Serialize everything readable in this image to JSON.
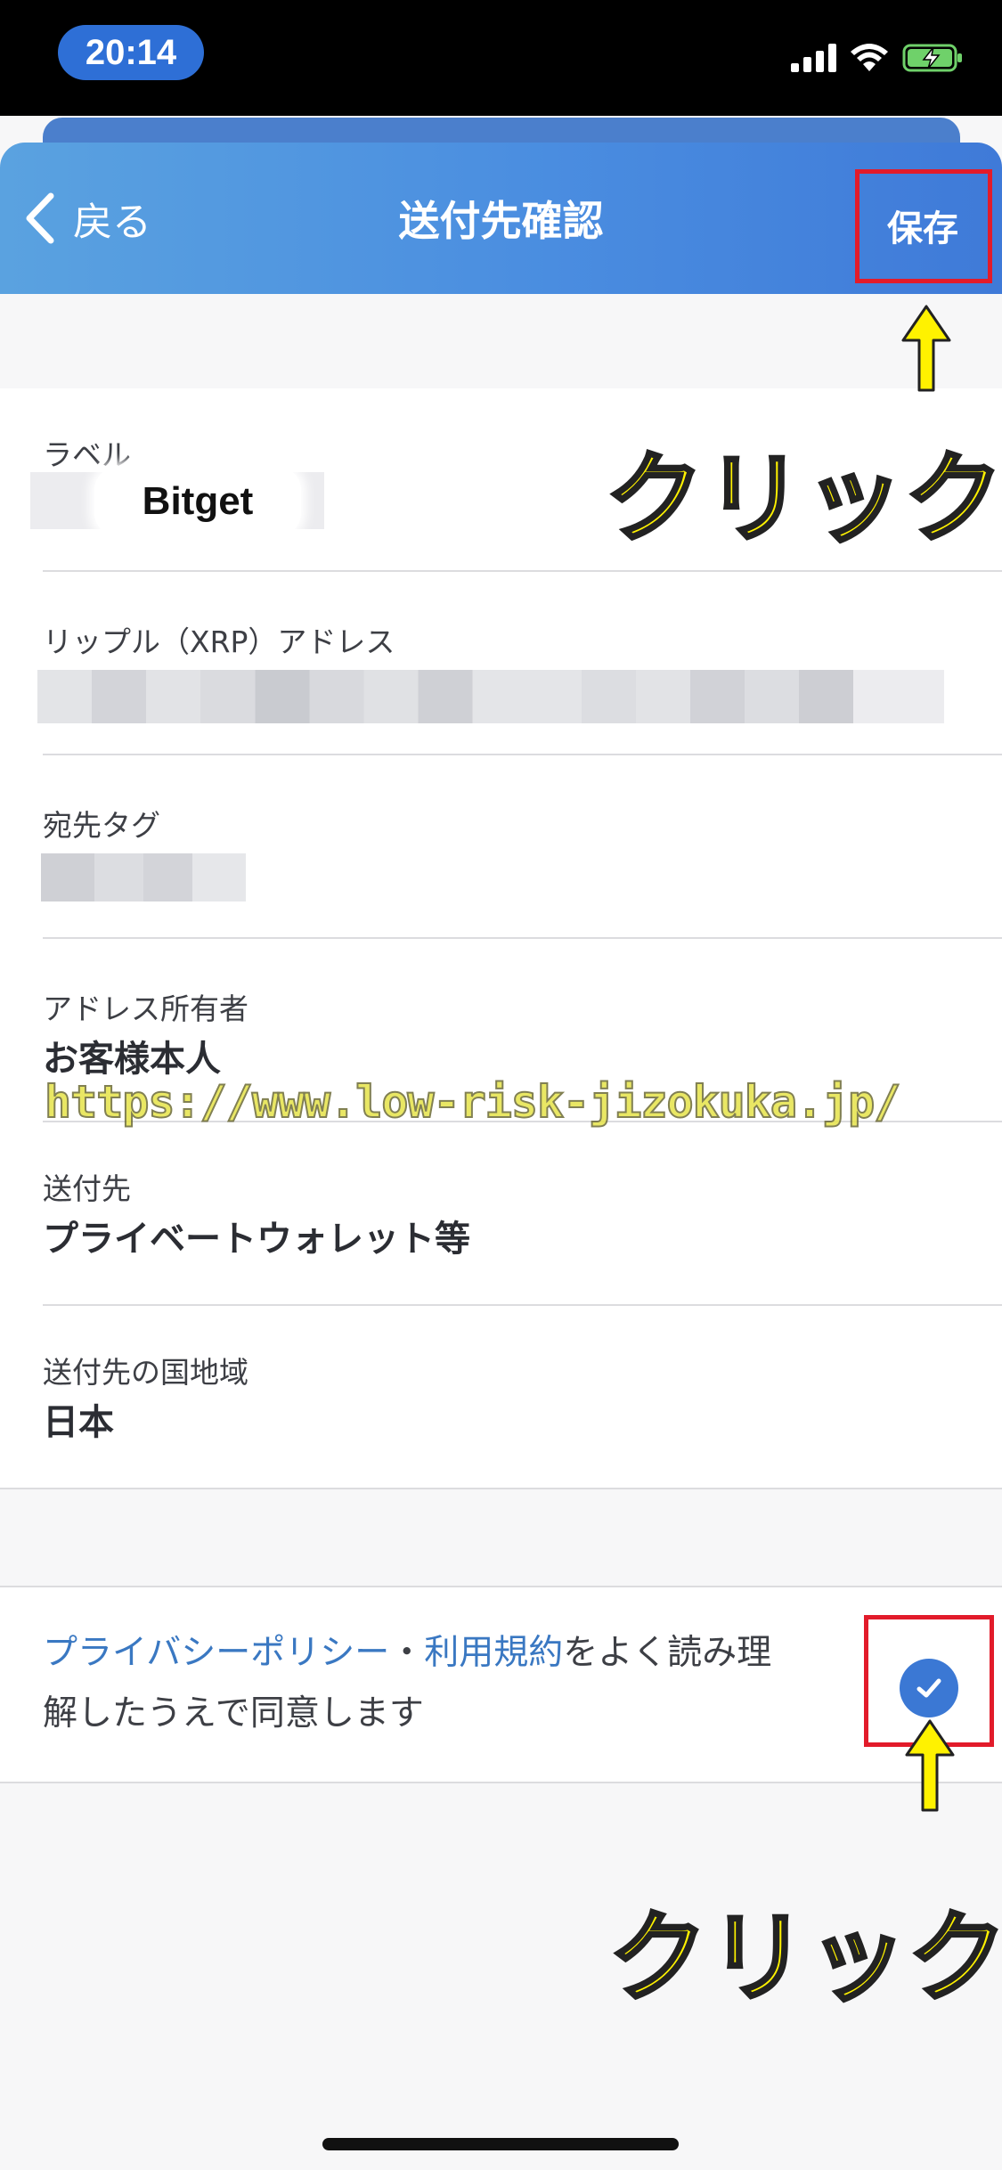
{
  "status_bar": {
    "time": "20:14"
  },
  "header": {
    "back_label": "戻る",
    "title": "送付先確認",
    "save_label": "保存"
  },
  "fields": {
    "label": {
      "label": "ラベル",
      "value": "Bitget"
    },
    "address": {
      "label": "リップル（XRP）アドレス"
    },
    "dest_tag": {
      "label": "宛先タグ"
    },
    "owner": {
      "label": "アドレス所有者",
      "value": "お客様本人"
    },
    "destination": {
      "label": "送付先",
      "value": "プライベートウォレット等"
    },
    "country": {
      "label": "送付先の国地域",
      "value": "日本"
    }
  },
  "agreement": {
    "privacy_link": "プライバシーポリシー",
    "separator": "・",
    "terms_link": "利用規約",
    "text_part1": "をよく読み理",
    "text_part2": "解したうえで同意します",
    "checked": true
  },
  "annotations": {
    "click_top": "クリック",
    "click_bottom": "クリック",
    "watermark": "https://www.low-risk-jizokuka.jp/",
    "highlight_color": "#e21b2a",
    "callout_color": "#fff200"
  },
  "colors": {
    "header_gradient_start": "#5aa2e0",
    "header_gradient_end": "#3f7ad8",
    "link": "#3a78c2",
    "checkbox": "#3b78d4"
  }
}
